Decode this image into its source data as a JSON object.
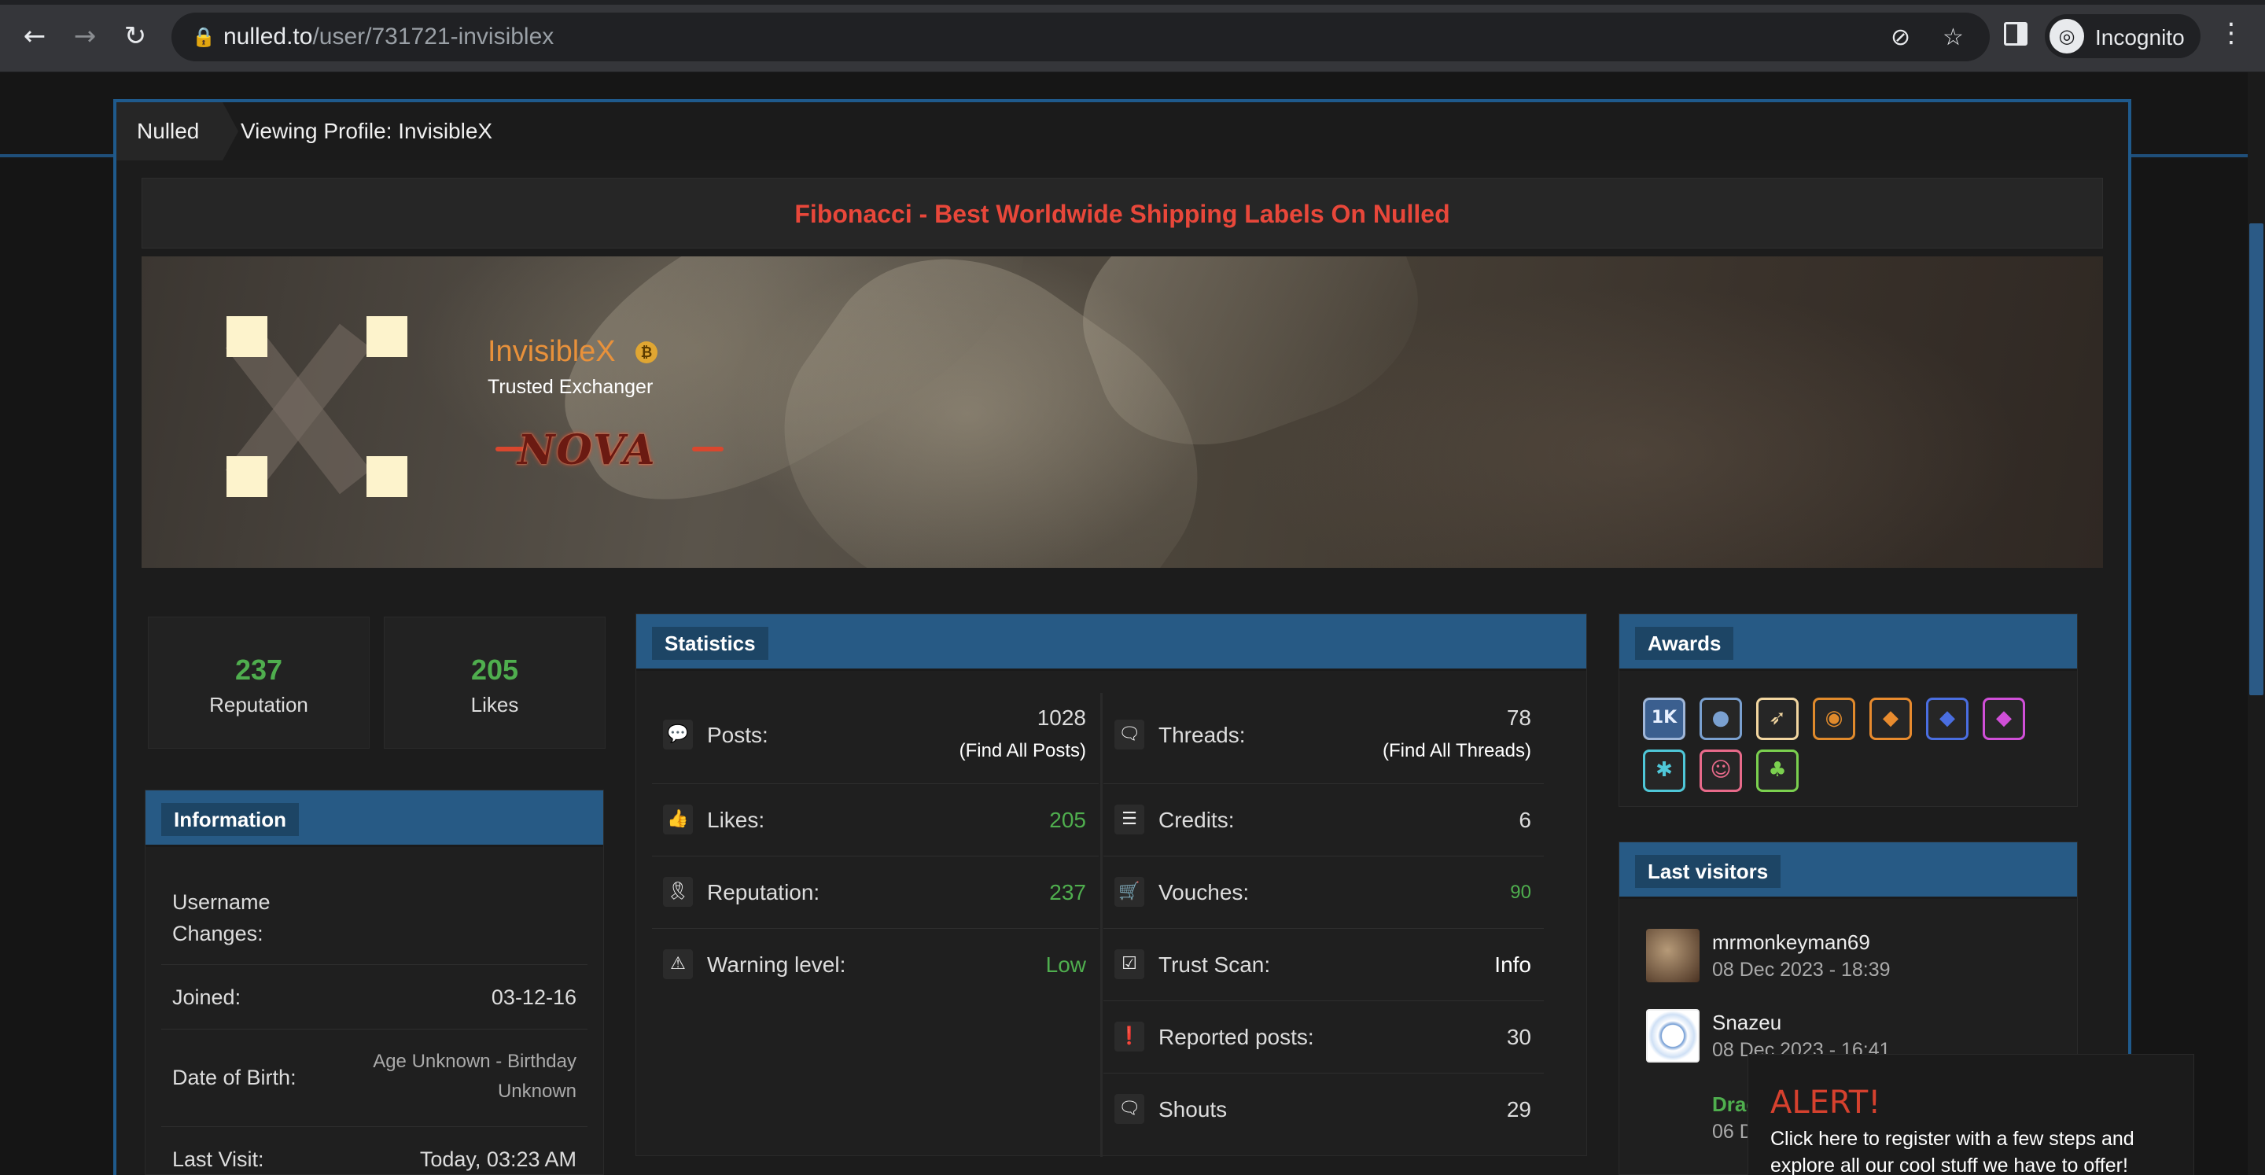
{
  "browser": {
    "url_host": "nulled.to",
    "url_path": "/user/731721-invisiblex",
    "profile_label": "Incognito"
  },
  "breadcrumb": {
    "home": "Nulled",
    "current": "Viewing Profile: InvisibleX"
  },
  "ad_bar": {
    "text": "Fibonacci - Best Worldwide Shipping Labels On Nulled",
    "color": "#e8473a"
  },
  "profile": {
    "name": "InvisibleX",
    "name_color": "#e8913b",
    "group": "Trusted Exchanger",
    "badge_text": "NOVA"
  },
  "stats_boxes": [
    {
      "value": "237",
      "label": "Reputation"
    },
    {
      "value": "205",
      "label": "Likes"
    }
  ],
  "information": {
    "title": "Information",
    "rows": [
      {
        "key": "Username Changes:",
        "value": ""
      },
      {
        "key": "Joined:",
        "value": "03-12-16"
      },
      {
        "key": "Date of Birth:",
        "value": "Age Unknown - Birthday Unknown"
      },
      {
        "key": "Last Visit:",
        "value": "Today, 03:23 AM"
      }
    ]
  },
  "statistics": {
    "title": "Statistics",
    "left": [
      {
        "icon": "speech-bubble-icon",
        "key": "Posts:",
        "value": "1028",
        "link": "Find All Posts"
      },
      {
        "icon": "thumbs-up-icon",
        "key": "Likes:",
        "value": "205"
      },
      {
        "icon": "ribbon-icon",
        "key": "Reputation:",
        "value": "237"
      },
      {
        "icon": "warning-icon",
        "key": "Warning level:",
        "value": "Low"
      }
    ],
    "right": [
      {
        "icon": "chat-bubbles-icon",
        "key": "Threads:",
        "value": "78",
        "link": "Find All Threads"
      },
      {
        "icon": "coins-icon",
        "key": "Credits:",
        "value": "6"
      },
      {
        "icon": "cart-icon",
        "key": "Vouches:",
        "value": "90"
      },
      {
        "icon": "checkbox-icon",
        "key": "Trust Scan:",
        "value": "Info"
      },
      {
        "icon": "exclamation-icon",
        "key": "Reported posts:",
        "value": "30"
      },
      {
        "icon": "chat-bubbles-icon",
        "key": "Shouts",
        "value": "29"
      }
    ]
  },
  "awards": {
    "title": "Awards",
    "items": [
      {
        "name": "1k-award-icon",
        "glyph": "1K",
        "color": "#9fb6d8"
      },
      {
        "name": "robot-award-icon",
        "glyph": "●",
        "color": "#7aa0d0"
      },
      {
        "name": "rocket-award-icon",
        "glyph": "➶",
        "color": "#f2d6a0"
      },
      {
        "name": "pumpkin-award-icon",
        "glyph": "◉",
        "color": "#e08a2c"
      },
      {
        "name": "orange-diamond-award-icon",
        "glyph": "◆",
        "color": "#e88b2e"
      },
      {
        "name": "blue-diamond-award-icon",
        "glyph": "◆",
        "color": "#4a6ee0"
      },
      {
        "name": "pink-diamond-award-icon",
        "glyph": "◆",
        "color": "#d04fd8"
      },
      {
        "name": "snowflake-award-icon",
        "glyph": "✱",
        "color": "#4fc7d8"
      },
      {
        "name": "face-award-icon",
        "glyph": "☺",
        "color": "#e86a8a"
      },
      {
        "name": "clover-award-icon",
        "glyph": "♣",
        "color": "#7bd04f"
      }
    ]
  },
  "last_visitors": {
    "title": "Last visitors",
    "items": [
      {
        "name": "mrmonkeyman69",
        "date": "08 Dec 2023 - 18:39"
      },
      {
        "name": "Snazeu",
        "date": "08 Dec 2023 - 16:41"
      },
      {
        "name": "Drag",
        "date": "06 D"
      }
    ]
  },
  "alert": {
    "title": "ALERT!",
    "message": "Click here to register with a few steps and explore all our cool stuff we have to offer!"
  }
}
